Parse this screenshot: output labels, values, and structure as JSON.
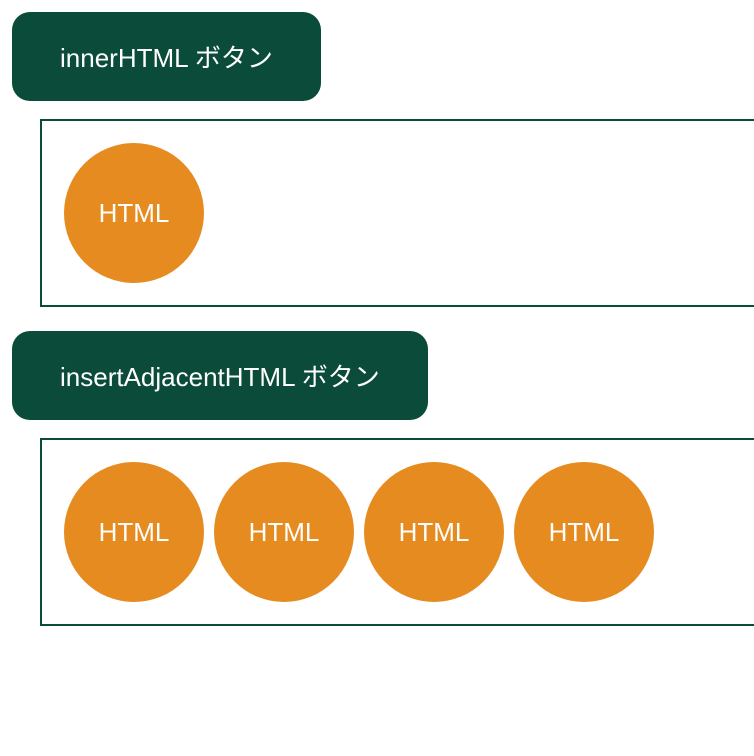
{
  "sections": [
    {
      "button_label": "innerHTML ボタン",
      "circles": [
        {
          "label": "HTML"
        }
      ]
    },
    {
      "button_label": "insertAdjacentHTML ボタン",
      "circles": [
        {
          "label": "HTML"
        },
        {
          "label": "HTML"
        },
        {
          "label": "HTML"
        },
        {
          "label": "HTML"
        }
      ]
    }
  ],
  "colors": {
    "button_bg": "#0b4b3a",
    "circle_bg": "#e58b1f",
    "border": "#0b4b3a"
  }
}
